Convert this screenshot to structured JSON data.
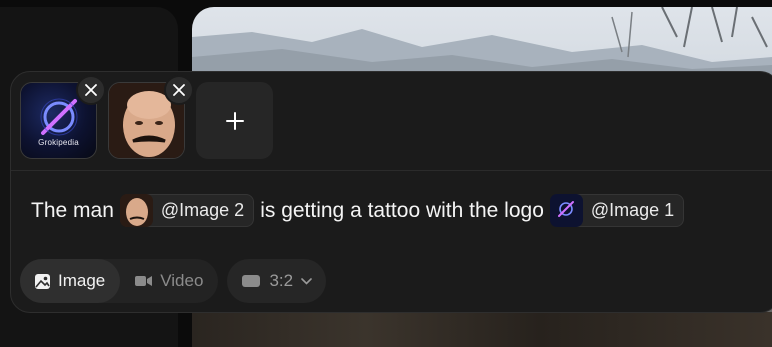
{
  "attachments": [
    {
      "name": "Image 1",
      "caption": "Grokipedia",
      "remove_icon": "close-icon"
    },
    {
      "name": "Image 2",
      "remove_icon": "close-icon"
    }
  ],
  "add_button": {
    "icon": "plus-icon"
  },
  "prompt": {
    "text_1": "The man",
    "mention_1": "@Image 2",
    "text_2": "is getting a tattoo with the logo",
    "mention_2": "@Image 1"
  },
  "mode": {
    "options": [
      {
        "label": "Image",
        "icon": "image-icon",
        "active": true
      },
      {
        "label": "Video",
        "icon": "video-icon",
        "active": false
      }
    ]
  },
  "aspect_ratio": {
    "value": "3:2",
    "icon": "aspect-ratio-icon",
    "dropdown_icon": "chevron-down-icon"
  },
  "colors": {
    "panel": "#1b1b1b",
    "active_pill": "#2f2f2f",
    "text": "#f2f2f2",
    "muted": "#8b8b8b"
  }
}
